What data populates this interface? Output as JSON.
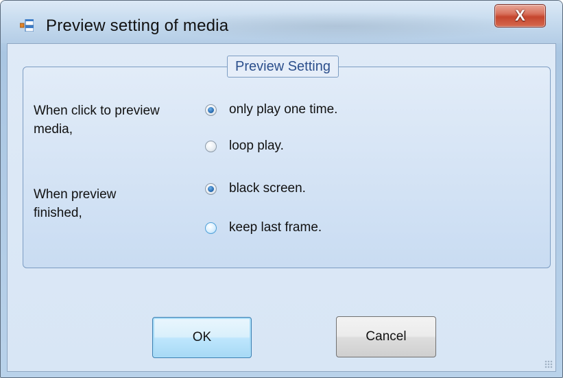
{
  "window": {
    "title": "Preview setting of media",
    "close_symbol": "X",
    "icon_name": "window-app-icon"
  },
  "group": {
    "title": "Preview Setting",
    "section1": {
      "label_line1": "When click to preview",
      "label_line2": "media,",
      "options": [
        {
          "label": "only play one time.",
          "checked": true
        },
        {
          "label": "loop play.",
          "checked": false
        }
      ]
    },
    "section2": {
      "label_line1": "When preview",
      "label_line2": "finished,",
      "options": [
        {
          "label": "black screen.",
          "checked": true
        },
        {
          "label": "keep last frame.",
          "checked": false
        }
      ]
    }
  },
  "buttons": {
    "ok": "OK",
    "cancel": "Cancel"
  },
  "colors": {
    "group_title_text": "#2c4f8c",
    "close_button": "#c5462e",
    "radio_dot": "#2d6fb3"
  }
}
